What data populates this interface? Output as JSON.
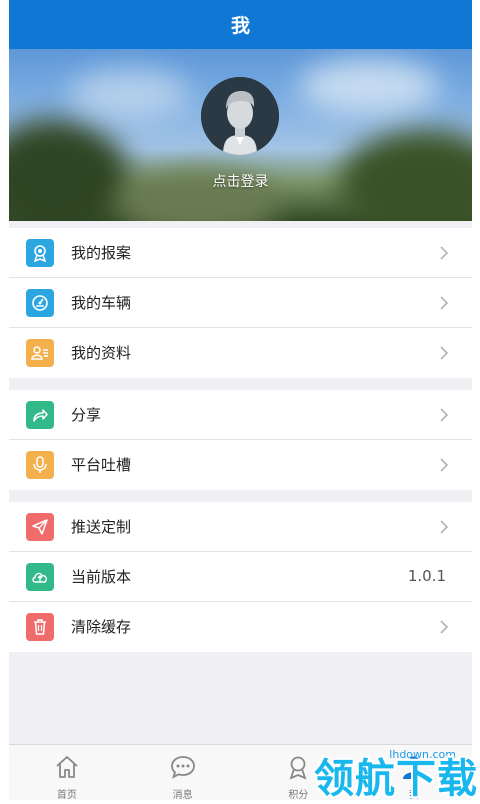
{
  "header": {
    "title": "我"
  },
  "profile": {
    "login_text": "点击登录"
  },
  "groups": [
    [
      {
        "id": "report",
        "label": "我的报案",
        "icon": "award-icon",
        "color": "#2ca6e0"
      },
      {
        "id": "vehicle",
        "label": "我的车辆",
        "icon": "gauge-icon",
        "color": "#2ca6e0"
      },
      {
        "id": "profile",
        "label": "我的资料",
        "icon": "id-card-icon",
        "color": "#f5b04e"
      }
    ],
    [
      {
        "id": "share",
        "label": "分享",
        "icon": "share-icon",
        "color": "#33b88a"
      },
      {
        "id": "feedback",
        "label": "平台吐槽",
        "icon": "mic-icon",
        "color": "#f5b04e"
      }
    ],
    [
      {
        "id": "push",
        "label": "推送定制",
        "icon": "send-icon",
        "color": "#f06b6b"
      },
      {
        "id": "version",
        "label": "当前版本",
        "icon": "cloud-upload-icon",
        "color": "#33b88a",
        "value": "1.0.1"
      },
      {
        "id": "cache",
        "label": "清除缓存",
        "icon": "trash-icon",
        "color": "#f06b6b"
      }
    ]
  ],
  "tabs": [
    {
      "label": "首页",
      "icon": "home-icon"
    },
    {
      "label": "消息",
      "icon": "chat-icon"
    },
    {
      "label": "积分",
      "icon": "medal-icon"
    },
    {
      "label": "我",
      "icon": "person-icon",
      "active": true
    }
  ],
  "watermark": {
    "domain": "lhdown.com",
    "text": "领航下载"
  },
  "colors": {
    "primary": "#1177d5",
    "background": "#efeff4"
  }
}
